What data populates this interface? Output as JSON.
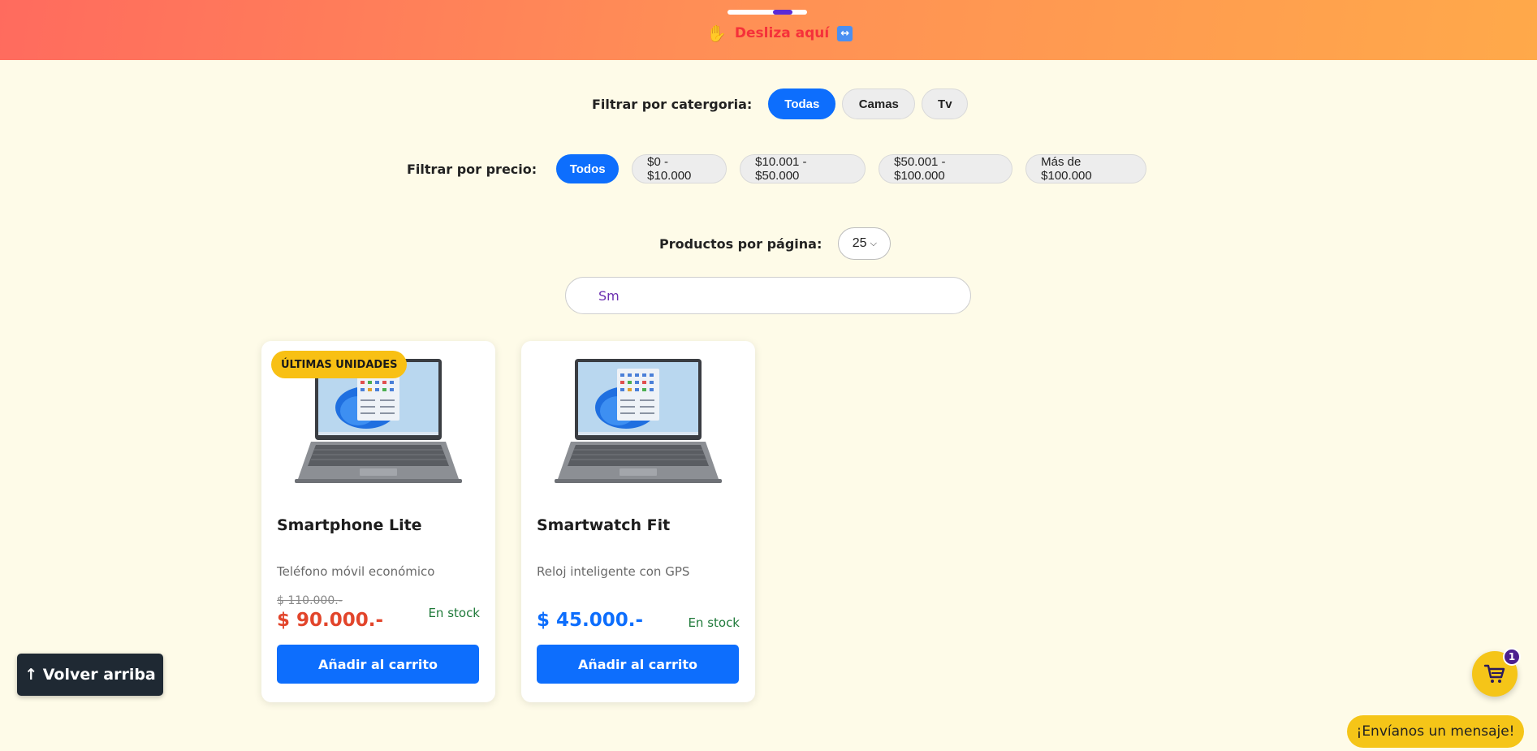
{
  "banner": {
    "swipe_text": "Desliza aquí",
    "hand_icon": "✋",
    "arrows_icon": "↔",
    "scroll_position_fraction": 0.75
  },
  "filters": {
    "category_label": "Filtrar por catergoria:",
    "categories": [
      {
        "label": "Todas",
        "active": true
      },
      {
        "label": "Camas",
        "active": false
      },
      {
        "label": "Tv",
        "active": false
      }
    ],
    "price_label": "Filtrar por precio:",
    "prices": [
      {
        "label": "Todos",
        "active": true
      },
      {
        "label": "$0 - $10.000",
        "active": false
      },
      {
        "label": "$10.001 - $50.000",
        "active": false
      },
      {
        "label": "$50.001 - $100.000",
        "active": false
      },
      {
        "label": "Más de $100.000",
        "active": false
      }
    ]
  },
  "pagination": {
    "per_page_label": "Productos por página:",
    "per_page_value": "25"
  },
  "search": {
    "value": "Sm"
  },
  "products": [
    {
      "badge": "ÚLTIMAS UNIDADES",
      "name": "Smartphone Lite",
      "description": "Teléfono móvil económico",
      "old_price": "$ 110.000.-",
      "price": "$ 90.000.-",
      "price_color": "#e2452b",
      "stock": "En stock",
      "button": "Añadir al carrito"
    },
    {
      "badge": "",
      "name": "Smartwatch Fit",
      "description": "Reloj inteligente con GPS",
      "old_price": "",
      "price": "$ 45.000.-",
      "price_color": "#0d6efd",
      "stock": "En stock",
      "button": "Añadir al carrito"
    }
  ],
  "floating": {
    "back_to_top": "↑ Volver arriba",
    "cart_count": "1",
    "message_button": "¡Envíanos un mensaje!"
  },
  "colors": {
    "primary": "#0d6efd",
    "accent_yellow": "#f5c518",
    "background": "#fefbe8"
  }
}
